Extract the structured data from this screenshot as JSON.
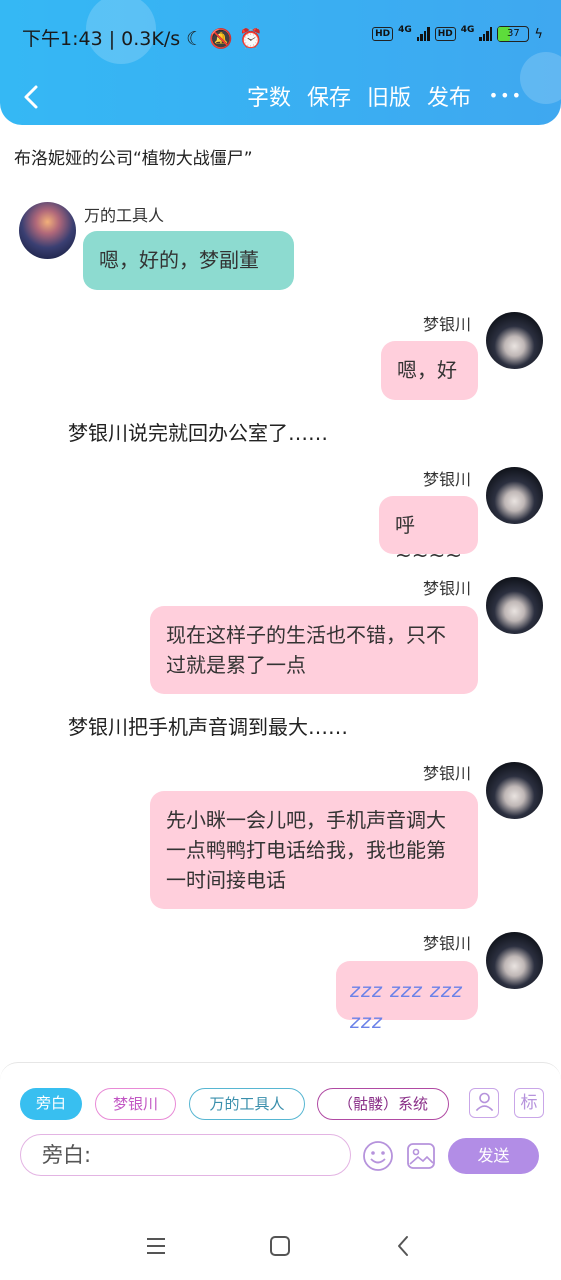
{
  "status_bar": {
    "time_speed": "下午1:43 | 0.3K/s",
    "network1": "4G",
    "network2": "4G",
    "hd": "HD",
    "battery": "37",
    "battery_level": 0.37
  },
  "toolbar": {
    "word_count": "字数",
    "save": "保存",
    "old_version": "旧版",
    "publish": "发布",
    "more": "•••"
  },
  "chat": {
    "title": "布洛妮娅的公司“植物大战僵尸”",
    "messages": [
      {
        "sender": "万的工具人",
        "text": "嗯，好的，梦副董"
      },
      {
        "sender": "梦银川",
        "text": "嗯，好"
      },
      {
        "narration": "梦银川说完就回办公室了……"
      },
      {
        "sender": "梦银川",
        "text": "呼~~~~"
      },
      {
        "sender": "梦银川",
        "text": "现在这样子的生活也不错，只不过就是累了一点"
      },
      {
        "narration": "梦银川把手机声音调到最大……"
      },
      {
        "sender": "梦银川",
        "text": "先小眯一会儿吧，手机声音调大一点鸭鸭打电话给我，我也能第一时间接电话"
      },
      {
        "sender": "梦银川",
        "text": "zzz zzz zzz zzz"
      }
    ]
  },
  "input_panel": {
    "roles": [
      "旁白",
      "梦银川",
      "万的工具人",
      "（骷髅）系统"
    ],
    "role_icon": "角",
    "tag_icon": "标",
    "input_value": "旁白:",
    "send": "发送"
  }
}
